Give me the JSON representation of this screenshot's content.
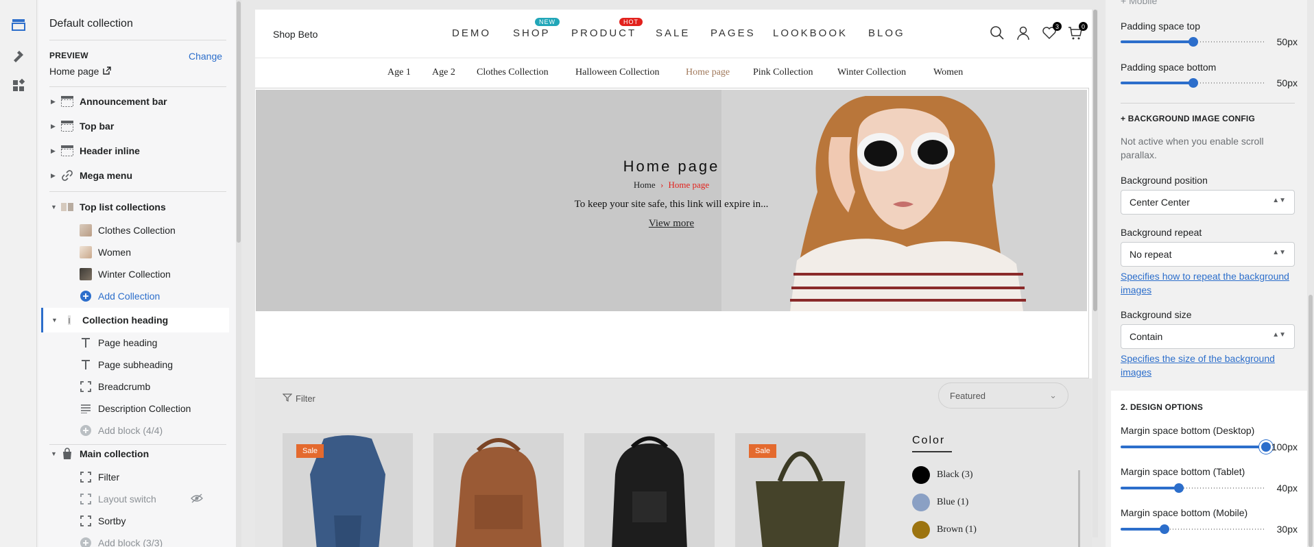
{
  "left_panel": {
    "title": "Default collection",
    "preview_label": "PREVIEW",
    "preview_change": "Change",
    "preview_page": "Home page",
    "sections": [
      {
        "label": "Announcement bar"
      },
      {
        "label": "Top bar"
      },
      {
        "label": "Header inline"
      },
      {
        "label": "Mega menu"
      }
    ],
    "top_list": {
      "label": "Top list collections",
      "items": [
        "Clothes Collection",
        "Women",
        "Winter Collection"
      ],
      "add": "Add Collection"
    },
    "collection_heading": {
      "label": "Collection heading",
      "blocks": [
        "Page heading",
        "Page subheading",
        "Breadcrumb",
        "Description Collection"
      ],
      "add": "Add block (4/4)"
    },
    "main_collection": {
      "label": "Main collection",
      "blocks": [
        "Filter",
        "Layout switch",
        "Sortby"
      ],
      "add": "Add block (3/3)"
    }
  },
  "preview": {
    "logo": "Shop Beto",
    "nav": [
      "DEMO",
      "SHOP",
      "PRODUCT",
      "SALE",
      "PAGES",
      "LOOKBOOK",
      "BLOG"
    ],
    "badges": {
      "shop": "NEW",
      "product": "HOT"
    },
    "wishlist_count": "3",
    "cart_count": "0",
    "subnav": [
      "Age 1",
      "Age 2",
      "Clothes Collection",
      "Halloween Collection",
      "Home page",
      "Pink Collection",
      "Winter Collection",
      "Women"
    ],
    "banner": {
      "title": "Home page",
      "crumb_home": "Home",
      "crumb_current": "Home page",
      "description": "To keep your site safe, this link will expire in...",
      "more": "View more"
    },
    "filter_label": "Filter",
    "sort_label": "Featured",
    "sale_label": "Sale",
    "color_title": "Color",
    "colors": [
      {
        "name": "Black (3)",
        "hex": "#000000"
      },
      {
        "name": "Blue (1)",
        "hex": "#8aa0c4"
      },
      {
        "name": "Brown (1)",
        "hex": "#9c7410"
      }
    ]
  },
  "right_panel": {
    "mobile_label": "+ Mobile",
    "padding_top_label": "Padding space top",
    "padding_top_value": "50px",
    "padding_bottom_label": "Padding space bottom",
    "padding_bottom_value": "50px",
    "bg_config_head": "+ BACKGROUND IMAGE CONFIG",
    "bg_hint": "Not active when you enable scroll parallax.",
    "bg_position_label": "Background position",
    "bg_position_value": "Center Center",
    "bg_repeat_label": "Background repeat",
    "bg_repeat_value": "No repeat",
    "bg_repeat_link": "Specifies how to repeat the background images",
    "bg_size_label": "Background size",
    "bg_size_value": "Contain",
    "bg_size_link": "Specifies the size of the background images",
    "design_head": "2. DESIGN OPTIONS",
    "margin_desktop_label": "Margin space bottom (Desktop)",
    "margin_desktop_value": "100px",
    "margin_tablet_label": "Margin space bottom (Tablet)",
    "margin_tablet_value": "40px",
    "margin_mobile_label": "Margin space bottom (Mobile)",
    "margin_mobile_value": "30px",
    "sliders": {
      "padding_top": 0.5,
      "padding_bottom": 0.5,
      "margin_desktop": 1.0,
      "margin_tablet": 0.4,
      "margin_mobile": 0.3
    }
  },
  "colors": {
    "accent": "#2c6ecb",
    "crumb": "#e2211c",
    "badge_new": "#21a6b8",
    "badge_hot": "#e2211c",
    "sale": "#e46a2e"
  }
}
